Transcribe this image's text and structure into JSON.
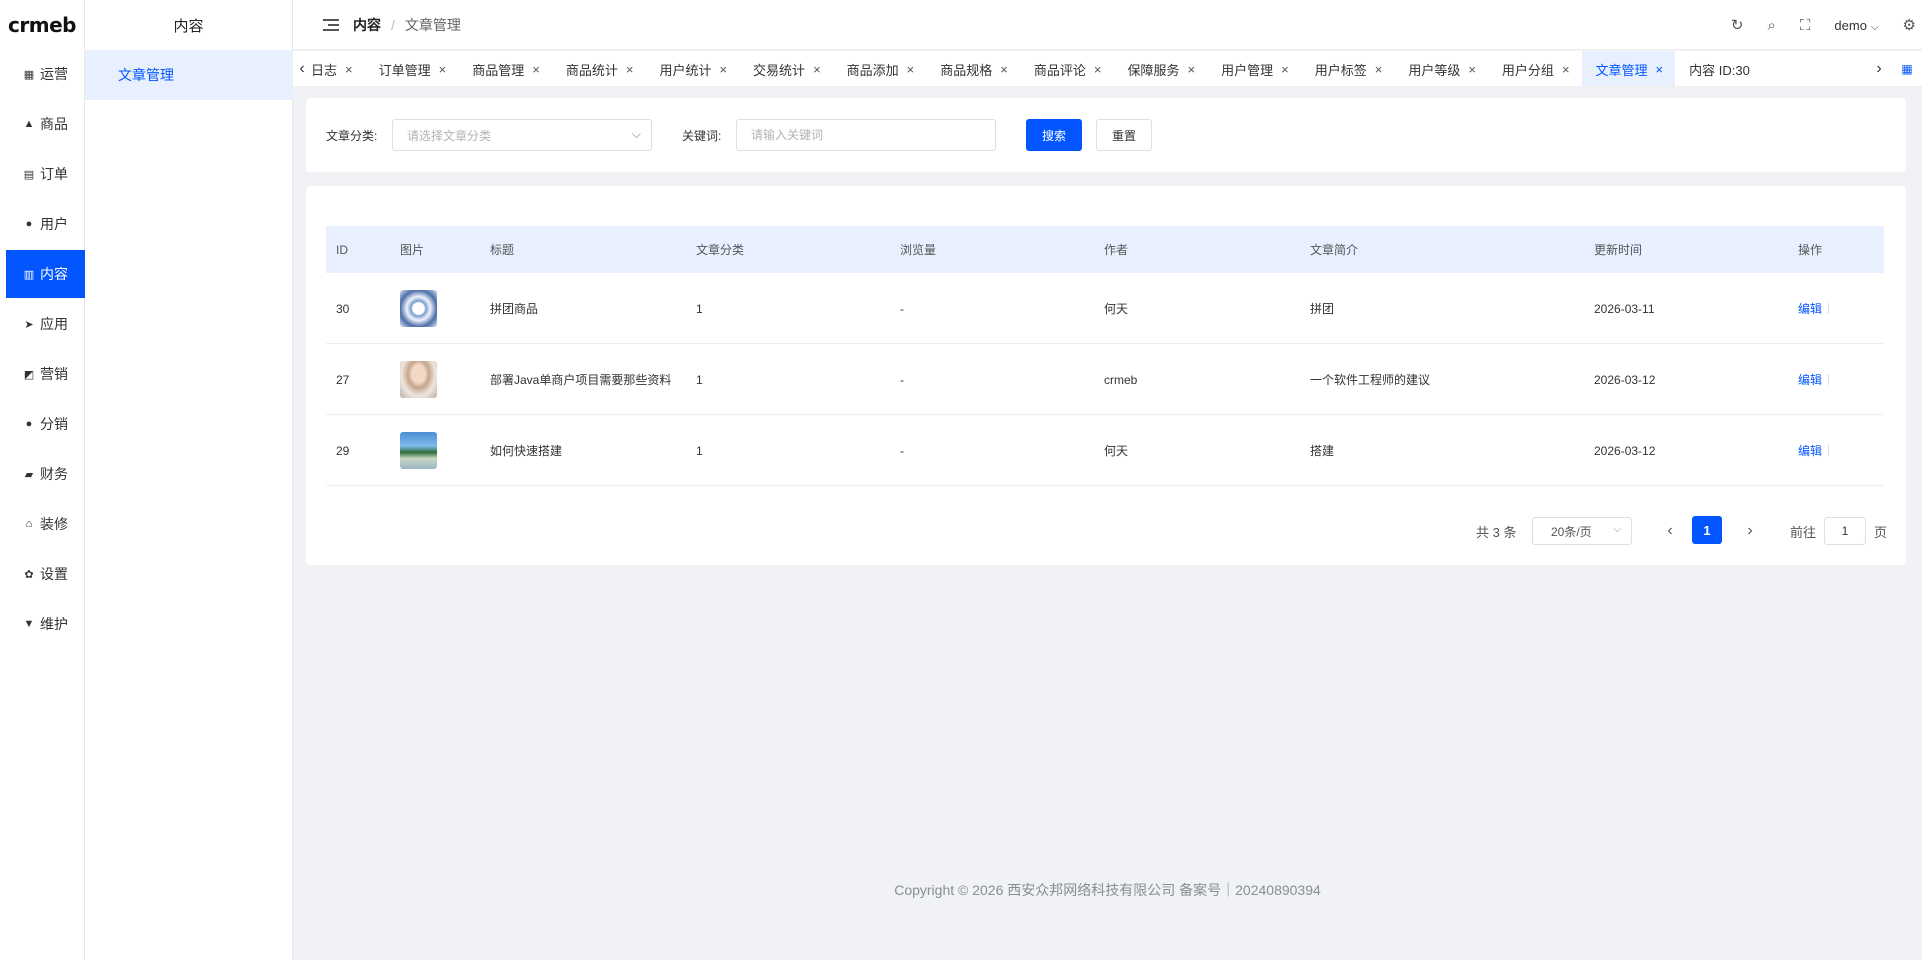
{
  "brand": {
    "logo_text": "crmeb"
  },
  "rail": {
    "items": [
      {
        "label": "运营",
        "icon": "grid-icon",
        "glyph": "▦"
      },
      {
        "label": "商品",
        "icon": "bag-icon",
        "glyph": "▲"
      },
      {
        "label": "订单",
        "icon": "clipboard-icon",
        "glyph": "▤"
      },
      {
        "label": "用户",
        "icon": "user-icon",
        "glyph": "●"
      },
      {
        "label": "内容",
        "icon": "book-icon",
        "glyph": "▥"
      },
      {
        "label": "应用",
        "icon": "send-icon",
        "glyph": "➤"
      },
      {
        "label": "营销",
        "icon": "chart-icon",
        "glyph": "◩"
      },
      {
        "label": "分销",
        "icon": "person-icon",
        "glyph": "●"
      },
      {
        "label": "财务",
        "icon": "wallet-icon",
        "glyph": "▰"
      },
      {
        "label": "装修",
        "icon": "home-icon",
        "glyph": "⌂"
      },
      {
        "label": "设置",
        "icon": "gear-icon",
        "glyph": "✿"
      },
      {
        "label": "维护",
        "icon": "brush-icon",
        "glyph": "▼"
      }
    ],
    "active_index": 4
  },
  "submenu": {
    "title": "内容",
    "items": [
      {
        "label": "文章管理"
      }
    ]
  },
  "header": {
    "breadcrumb": [
      "内容",
      "文章管理"
    ],
    "separator": "/",
    "user": "demo"
  },
  "tabs": {
    "items": [
      {
        "label": "日志"
      },
      {
        "label": "订单管理"
      },
      {
        "label": "商品管理"
      },
      {
        "label": "商品统计"
      },
      {
        "label": "用户统计"
      },
      {
        "label": "交易统计"
      },
      {
        "label": "商品添加"
      },
      {
        "label": "商品规格"
      },
      {
        "label": "商品评论"
      },
      {
        "label": "保障服务"
      },
      {
        "label": "用户管理"
      },
      {
        "label": "用户标签"
      },
      {
        "label": "用户等级"
      },
      {
        "label": "用户分组"
      },
      {
        "label": "文章管理"
      },
      {
        "label": "内容 ID:30"
      }
    ],
    "active_index": 14,
    "close_glyph": "×"
  },
  "search": {
    "category_label": "文章分类:",
    "category_placeholder": "请选择文章分类",
    "keyword_label": "关键词:",
    "keyword_placeholder": "请输入关键词",
    "search_button": "搜索",
    "reset_button": "重置"
  },
  "table": {
    "columns": [
      "ID",
      "图片",
      "标题",
      "文章分类",
      "浏览量",
      "作者",
      "文章简介",
      "更新时间",
      "操作"
    ],
    "rows": [
      {
        "id": "30",
        "title": "拼团商品",
        "category": "1",
        "views": "-",
        "author": "何天",
        "intro": "拼团",
        "updated": "2026-03-11",
        "action": "编辑"
      },
      {
        "id": "27",
        "title": "部署Java单商户项目需要那些资料",
        "category": "1",
        "views": "-",
        "author": "crmeb",
        "intro": "一个软件工程师的建议",
        "updated": "2026-03-12",
        "action": "编辑"
      },
      {
        "id": "29",
        "title": "如何快速搭建",
        "category": "1",
        "views": "-",
        "author": "何天",
        "intro": "搭建",
        "updated": "2026-03-12",
        "action": "编辑"
      }
    ]
  },
  "pagination": {
    "total_text": "共 3 条",
    "page_size": "20条/页",
    "current_page": "1",
    "goto_prefix": "前往",
    "goto_value": "1",
    "goto_suffix": "页"
  },
  "footer": {
    "text": "Copyright © 2026 西安众邦网络科技有限公司 备案号｜20240890394"
  },
  "colors": {
    "accent": "#0256ff",
    "accent_light": "#e8f0ff",
    "background": "#f0f2f5"
  }
}
